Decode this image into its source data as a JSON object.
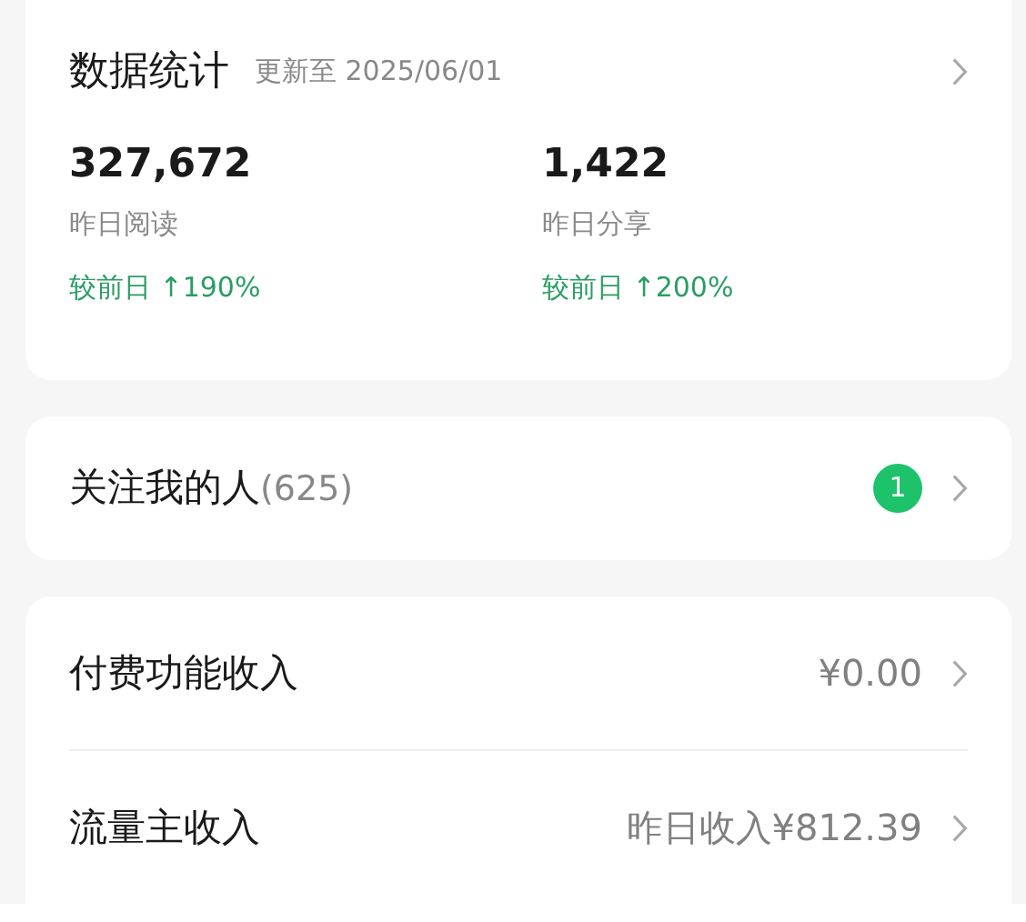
{
  "stats": {
    "title": "数据统计",
    "updated": "更新至 2025/06/01",
    "metrics": [
      {
        "value": "327,672",
        "label": "昨日阅读",
        "change": "较前日 ↑190%"
      },
      {
        "value": "1,422",
        "label": "昨日分享",
        "change": "较前日 ↑200%"
      }
    ]
  },
  "followers": {
    "label": "关注我的人",
    "count": "(625)",
    "badge": "1"
  },
  "income": [
    {
      "label": "付费功能收入",
      "value": "¥0.00"
    },
    {
      "label": "流量主收入",
      "value": "昨日收入¥812.39"
    }
  ]
}
